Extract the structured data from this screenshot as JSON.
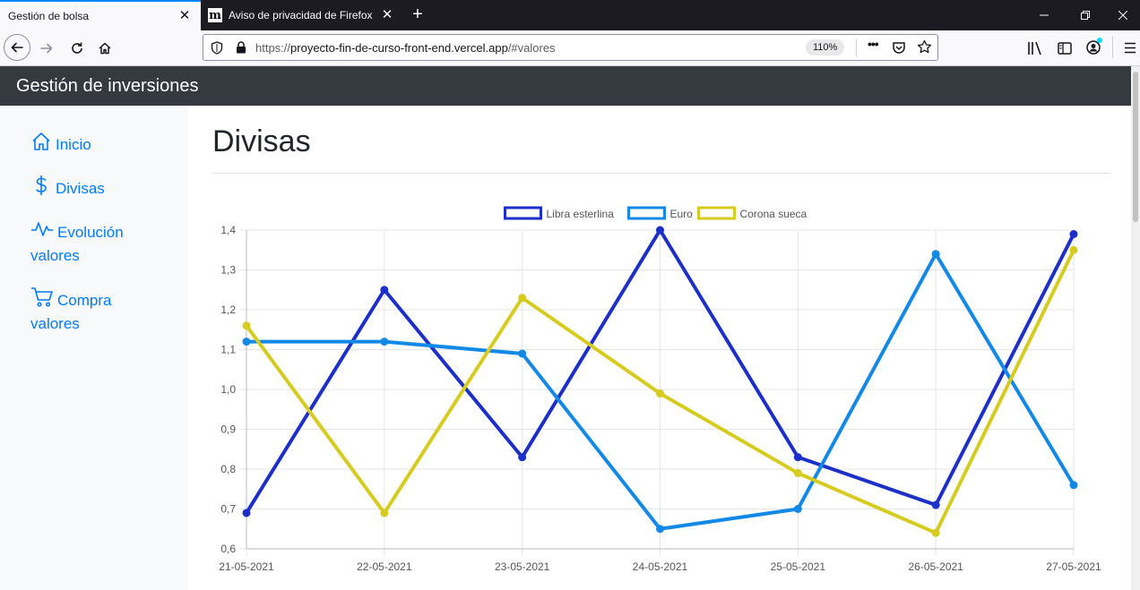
{
  "browser": {
    "tabs": [
      {
        "title": "Gestión de bolsa",
        "active": true
      },
      {
        "title": "Aviso de privacidad de Firefox",
        "active": false,
        "favicon": "m"
      }
    ],
    "url": {
      "scheme": "https://",
      "host": "proyecto-fin-de-curso-front-end.vercel.app",
      "path": "/#valores"
    },
    "zoom": "110%"
  },
  "app": {
    "title": "Gestión de inversiones"
  },
  "sidebar": {
    "items": [
      {
        "line1": "Inicio",
        "line2": "",
        "icon": "house-icon"
      },
      {
        "line1": "Divisas",
        "line2": "",
        "icon": "dollar-icon"
      },
      {
        "line1": "Evolución",
        "line2": "valores",
        "icon": "activity-icon"
      },
      {
        "line1": "Compra",
        "line2": "valores",
        "icon": "cart-icon"
      }
    ]
  },
  "page": {
    "title": "Divisas"
  },
  "chart_data": {
    "type": "line",
    "categories": [
      "21-05-2021",
      "22-05-2021",
      "23-05-2021",
      "24-05-2021",
      "25-05-2021",
      "26-05-2021",
      "27-05-2021"
    ],
    "yticks": [
      "0,6",
      "0,7",
      "0,8",
      "0,9",
      "1,0",
      "1,1",
      "1,2",
      "1,3",
      "1,4"
    ],
    "ylim": [
      0.6,
      1.4
    ],
    "grid": true,
    "legend": "top-center",
    "series": [
      {
        "name": "Libra esterlina",
        "color": "#1c2fc8",
        "values": [
          0.69,
          1.25,
          0.83,
          1.4,
          0.83,
          0.71,
          1.39
        ]
      },
      {
        "name": "Euro",
        "color": "#1289e6",
        "values": [
          1.12,
          1.12,
          1.09,
          0.65,
          0.7,
          1.34,
          0.76
        ]
      },
      {
        "name": "Corona sueca",
        "color": "#d6cb1e",
        "values": [
          1.16,
          0.69,
          1.23,
          0.99,
          0.79,
          0.64,
          1.35
        ]
      }
    ]
  }
}
